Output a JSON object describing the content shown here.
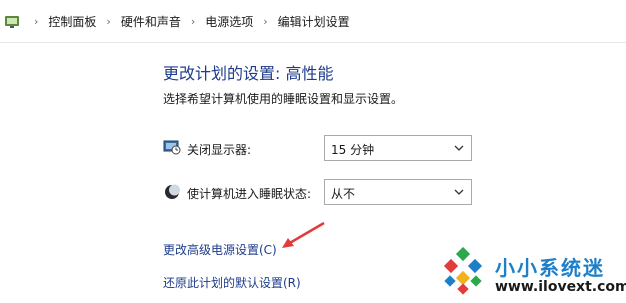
{
  "breadcrumb": {
    "items": [
      "控制面板",
      "硬件和声音",
      "电源选项",
      "编辑计划设置"
    ]
  },
  "page": {
    "title": "更改计划的设置: 高性能",
    "subtitle": "选择希望计算机使用的睡眠设置和显示设置。"
  },
  "settings": {
    "display_off_label": "关闭显示器:",
    "display_off_value": "15 分钟",
    "sleep_label": "使计算机进入睡眠状态:",
    "sleep_value": "从不"
  },
  "links": {
    "advanced": "更改高级电源设置(C)",
    "restore": "还原此计划的默认设置(R)"
  },
  "watermark": {
    "title": "小小系统迷",
    "url": "www.ilovext.com"
  },
  "colors": {
    "link": "#1e3c8c",
    "arrow": "#e23b3b",
    "watermark_title": "#1e7fc9"
  }
}
